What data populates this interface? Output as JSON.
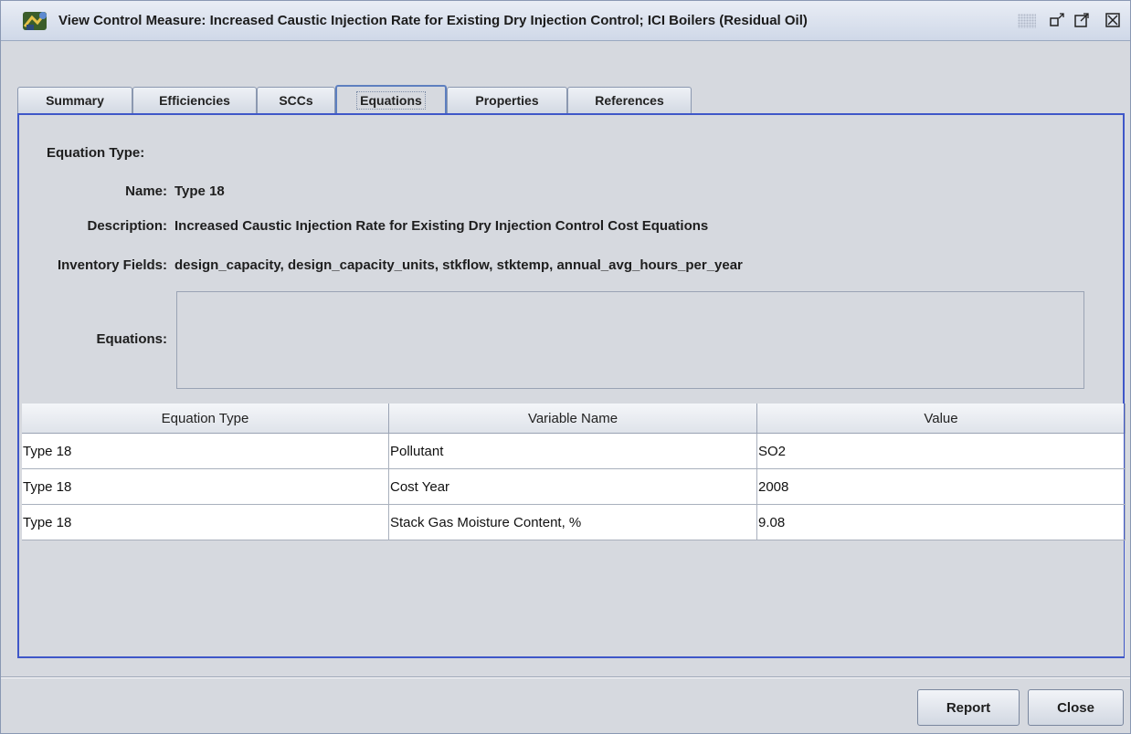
{
  "window": {
    "title": "View Control Measure: Increased Caustic Injection Rate for Existing Dry Injection Control; ICI Boilers (Residual Oil)"
  },
  "tabs": [
    {
      "label": "Summary"
    },
    {
      "label": "Efficiencies"
    },
    {
      "label": "SCCs"
    },
    {
      "label": "Equations"
    },
    {
      "label": "Properties"
    },
    {
      "label": "References"
    }
  ],
  "active_tab": "Equations",
  "form": {
    "equation_type_label": "Equation Type:",
    "name_label": "Name:",
    "name_value": "Type 18",
    "description_label": "Description:",
    "description_value": "Increased Caustic Injection Rate for Existing Dry Injection Control Cost Equations",
    "inventory_fields_label": "Inventory Fields:",
    "inventory_fields_value": "design_capacity, design_capacity_units, stkflow, stktemp, annual_avg_hours_per_year",
    "equations_label": "Equations:",
    "equations_value": ""
  },
  "table": {
    "columns": [
      "Equation Type",
      "Variable Name",
      "Value"
    ],
    "rows": [
      [
        "Type 18",
        "Pollutant",
        "SO2"
      ],
      [
        "Type 18",
        "Cost Year",
        "2008"
      ],
      [
        "Type 18",
        "Stack Gas Moisture Content, %",
        "9.08"
      ]
    ]
  },
  "buttons": {
    "report": "Report",
    "close": "Close"
  },
  "icons": {
    "app": "control-measure-app-icon",
    "restore": "restore-icon",
    "maximize": "maximize-icon",
    "close": "close-icon"
  },
  "colors": {
    "panel_border": "#3f57c8",
    "background": "#d6d9df"
  }
}
